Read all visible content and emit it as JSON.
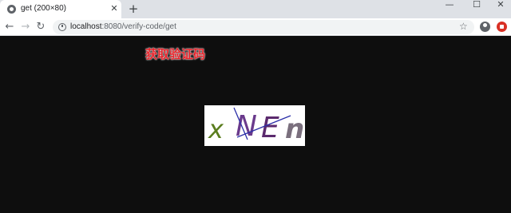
{
  "browser": {
    "tab_title": "get (200×80)",
    "tab_close": "✕",
    "new_tab": "+",
    "url_host": "localhost",
    "url_rest": ":8080/verify-code/get",
    "window_minimize": "—",
    "window_maximize": "☐",
    "window_close": "✕",
    "back": "←",
    "forward": "→",
    "reload": "↻",
    "star": "☆"
  },
  "page": {
    "heading": "获取验证码",
    "captcha": {
      "text": "xNEn",
      "letters": [
        {
          "char": "x",
          "color": "#5a7d1e"
        },
        {
          "char": "N",
          "color": "#6a3a8c"
        },
        {
          "char": "E",
          "color": "#5b2a6e"
        },
        {
          "char": "n",
          "color": "#7a6f7d"
        }
      ],
      "line_color": "#2b2fa8"
    }
  }
}
